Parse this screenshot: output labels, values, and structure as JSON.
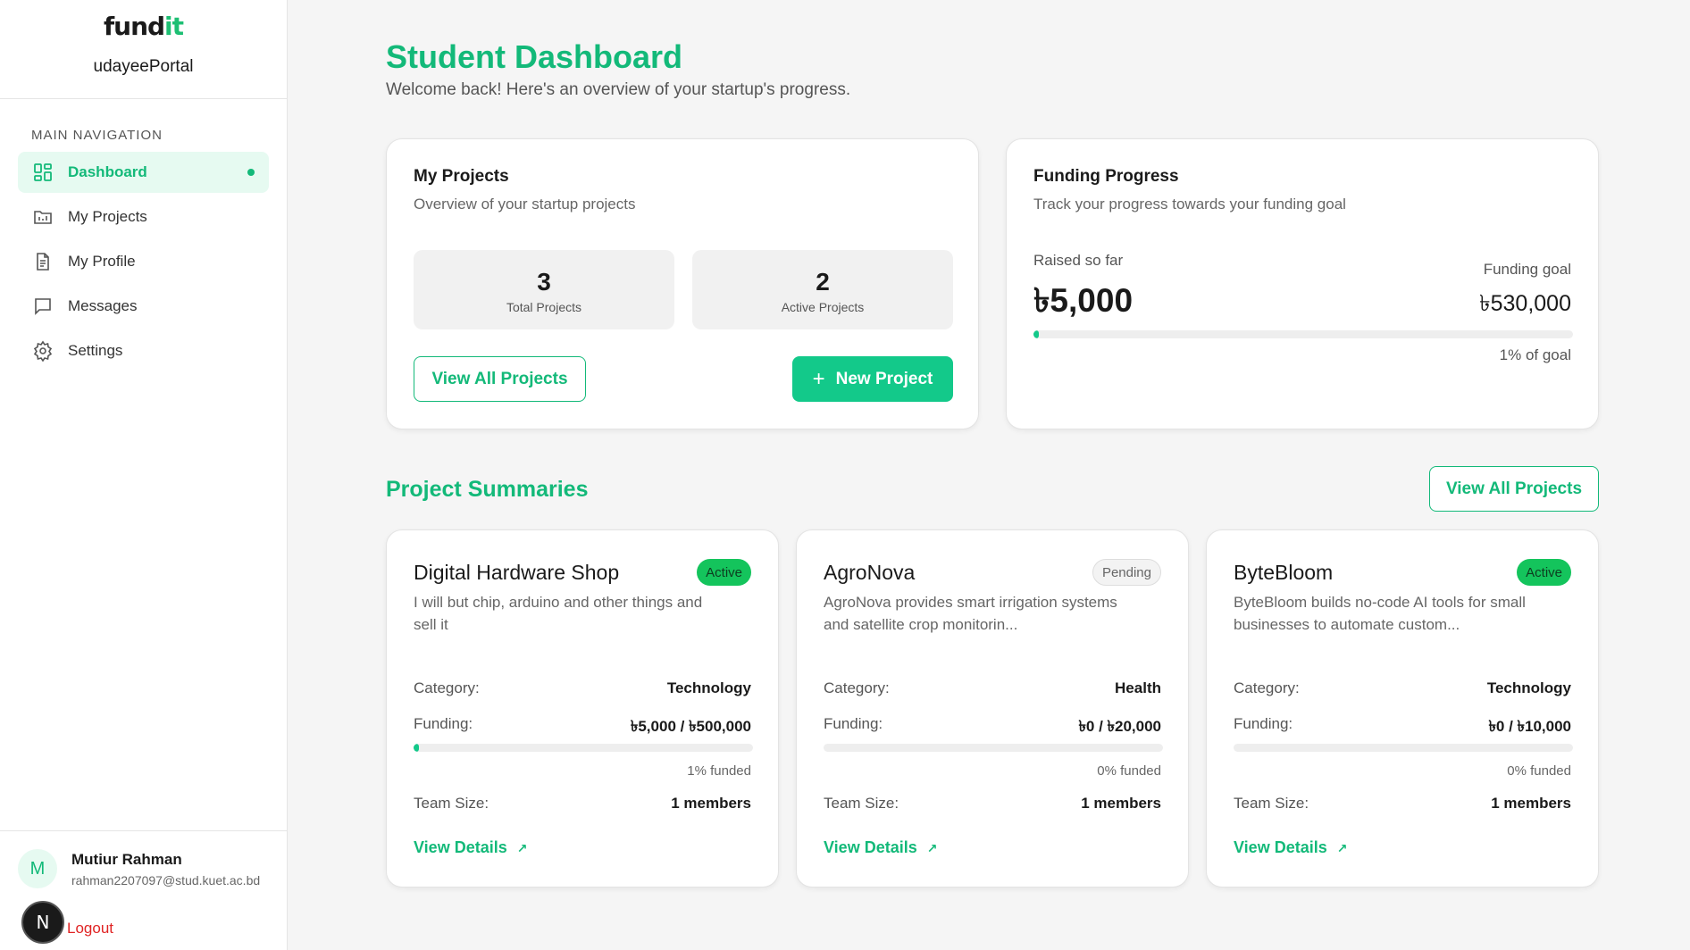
{
  "sidebar": {
    "logo_a": "fund",
    "logo_b": "it",
    "portal": "udayeePortal",
    "nav_heading": "MAIN NAVIGATION",
    "items": [
      {
        "label": "Dashboard",
        "icon": "grid-icon",
        "active": true
      },
      {
        "label": "My Projects",
        "icon": "folder-icon"
      },
      {
        "label": "My Profile",
        "icon": "document-icon"
      },
      {
        "label": "Messages",
        "icon": "chat-icon"
      },
      {
        "label": "Settings",
        "icon": "gear-icon"
      }
    ],
    "user": {
      "initial": "M",
      "name": "Mutiur Rahman",
      "email": "rahman2207097@stud.kuet.ac.bd"
    },
    "n_badge": "N",
    "logout": "Logout"
  },
  "header": {
    "title": "Student Dashboard",
    "subtitle": "Welcome back! Here's an overview of your startup's progress."
  },
  "my_projects": {
    "title": "My Projects",
    "subtitle": "Overview of your startup projects",
    "total": "3",
    "total_label": "Total Projects",
    "active": "2",
    "active_label": "Active Projects",
    "view_all": "View All Projects",
    "new_project": "New Project"
  },
  "funding": {
    "title": "Funding Progress",
    "subtitle": "Track your progress towards your funding goal",
    "raised_label": "Raised so far",
    "raised": "৳5,000",
    "goal_label": "Funding goal",
    "goal": "৳530,000",
    "percent_text": "1% of goal",
    "percent": 0.01
  },
  "summaries": {
    "title": "Project Summaries",
    "view_all": "View All Projects",
    "labels": {
      "category": "Category:",
      "funding": "Funding:",
      "team": "Team Size:",
      "view_details": "View Details"
    },
    "projects": [
      {
        "name": "Digital Hardware Shop",
        "status": "Active",
        "desc": "I will but chip, arduino and other things and sell it",
        "category": "Technology",
        "funding": "৳5,000 / ৳500,000",
        "funded_text": "1% funded",
        "funded": 0.01,
        "team": "1 members"
      },
      {
        "name": "AgroNova",
        "status": "Pending",
        "desc": "AgroNova provides smart irrigation systems and satellite crop monitorin...",
        "category": "Health",
        "funding": "৳0 / ৳20,000",
        "funded_text": "0% funded",
        "funded": 0,
        "team": "1 members"
      },
      {
        "name": "ByteBloom",
        "status": "Active",
        "desc": "ByteBloom builds no-code AI tools for small businesses to automate custom...",
        "category": "Technology",
        "funding": "৳0 / ৳10,000",
        "funded_text": "0% funded",
        "funded": 0,
        "team": "1 members"
      }
    ]
  },
  "colors": {
    "accent": "#13b979",
    "accent_solid": "#13c98a",
    "active_badge": "#14c45c",
    "logout": "#e02424"
  }
}
